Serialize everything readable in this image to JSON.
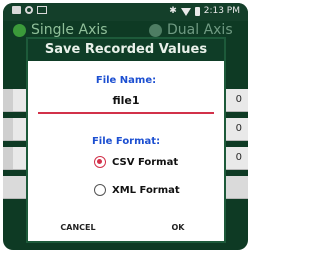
{
  "status_bar": {
    "time": "2:13 PM",
    "bluetooth_glyph": "✱"
  },
  "tabs": [
    {
      "label": "Single Axis",
      "active": true
    },
    {
      "label": "Dual Axis",
      "active": false
    }
  ],
  "background_rows": [
    {
      "tail": "0"
    },
    {
      "tail": "0"
    },
    {
      "tail": "0"
    }
  ],
  "dialog": {
    "title": "Save Recorded Values",
    "file_name_label": "File Name:",
    "file_name_value": "file1",
    "file_format_label": "File Format:",
    "options": [
      {
        "label": "CSV Format",
        "selected": true
      },
      {
        "label": "XML Format",
        "selected": false
      }
    ],
    "cancel_label": "CANCEL",
    "ok_label": "OK"
  },
  "colors": {
    "header_bg": "#0f3d27",
    "accent_red": "#d2314a",
    "label_blue": "#1c4fd1",
    "tab_active_dot": "#3b9a3a"
  }
}
